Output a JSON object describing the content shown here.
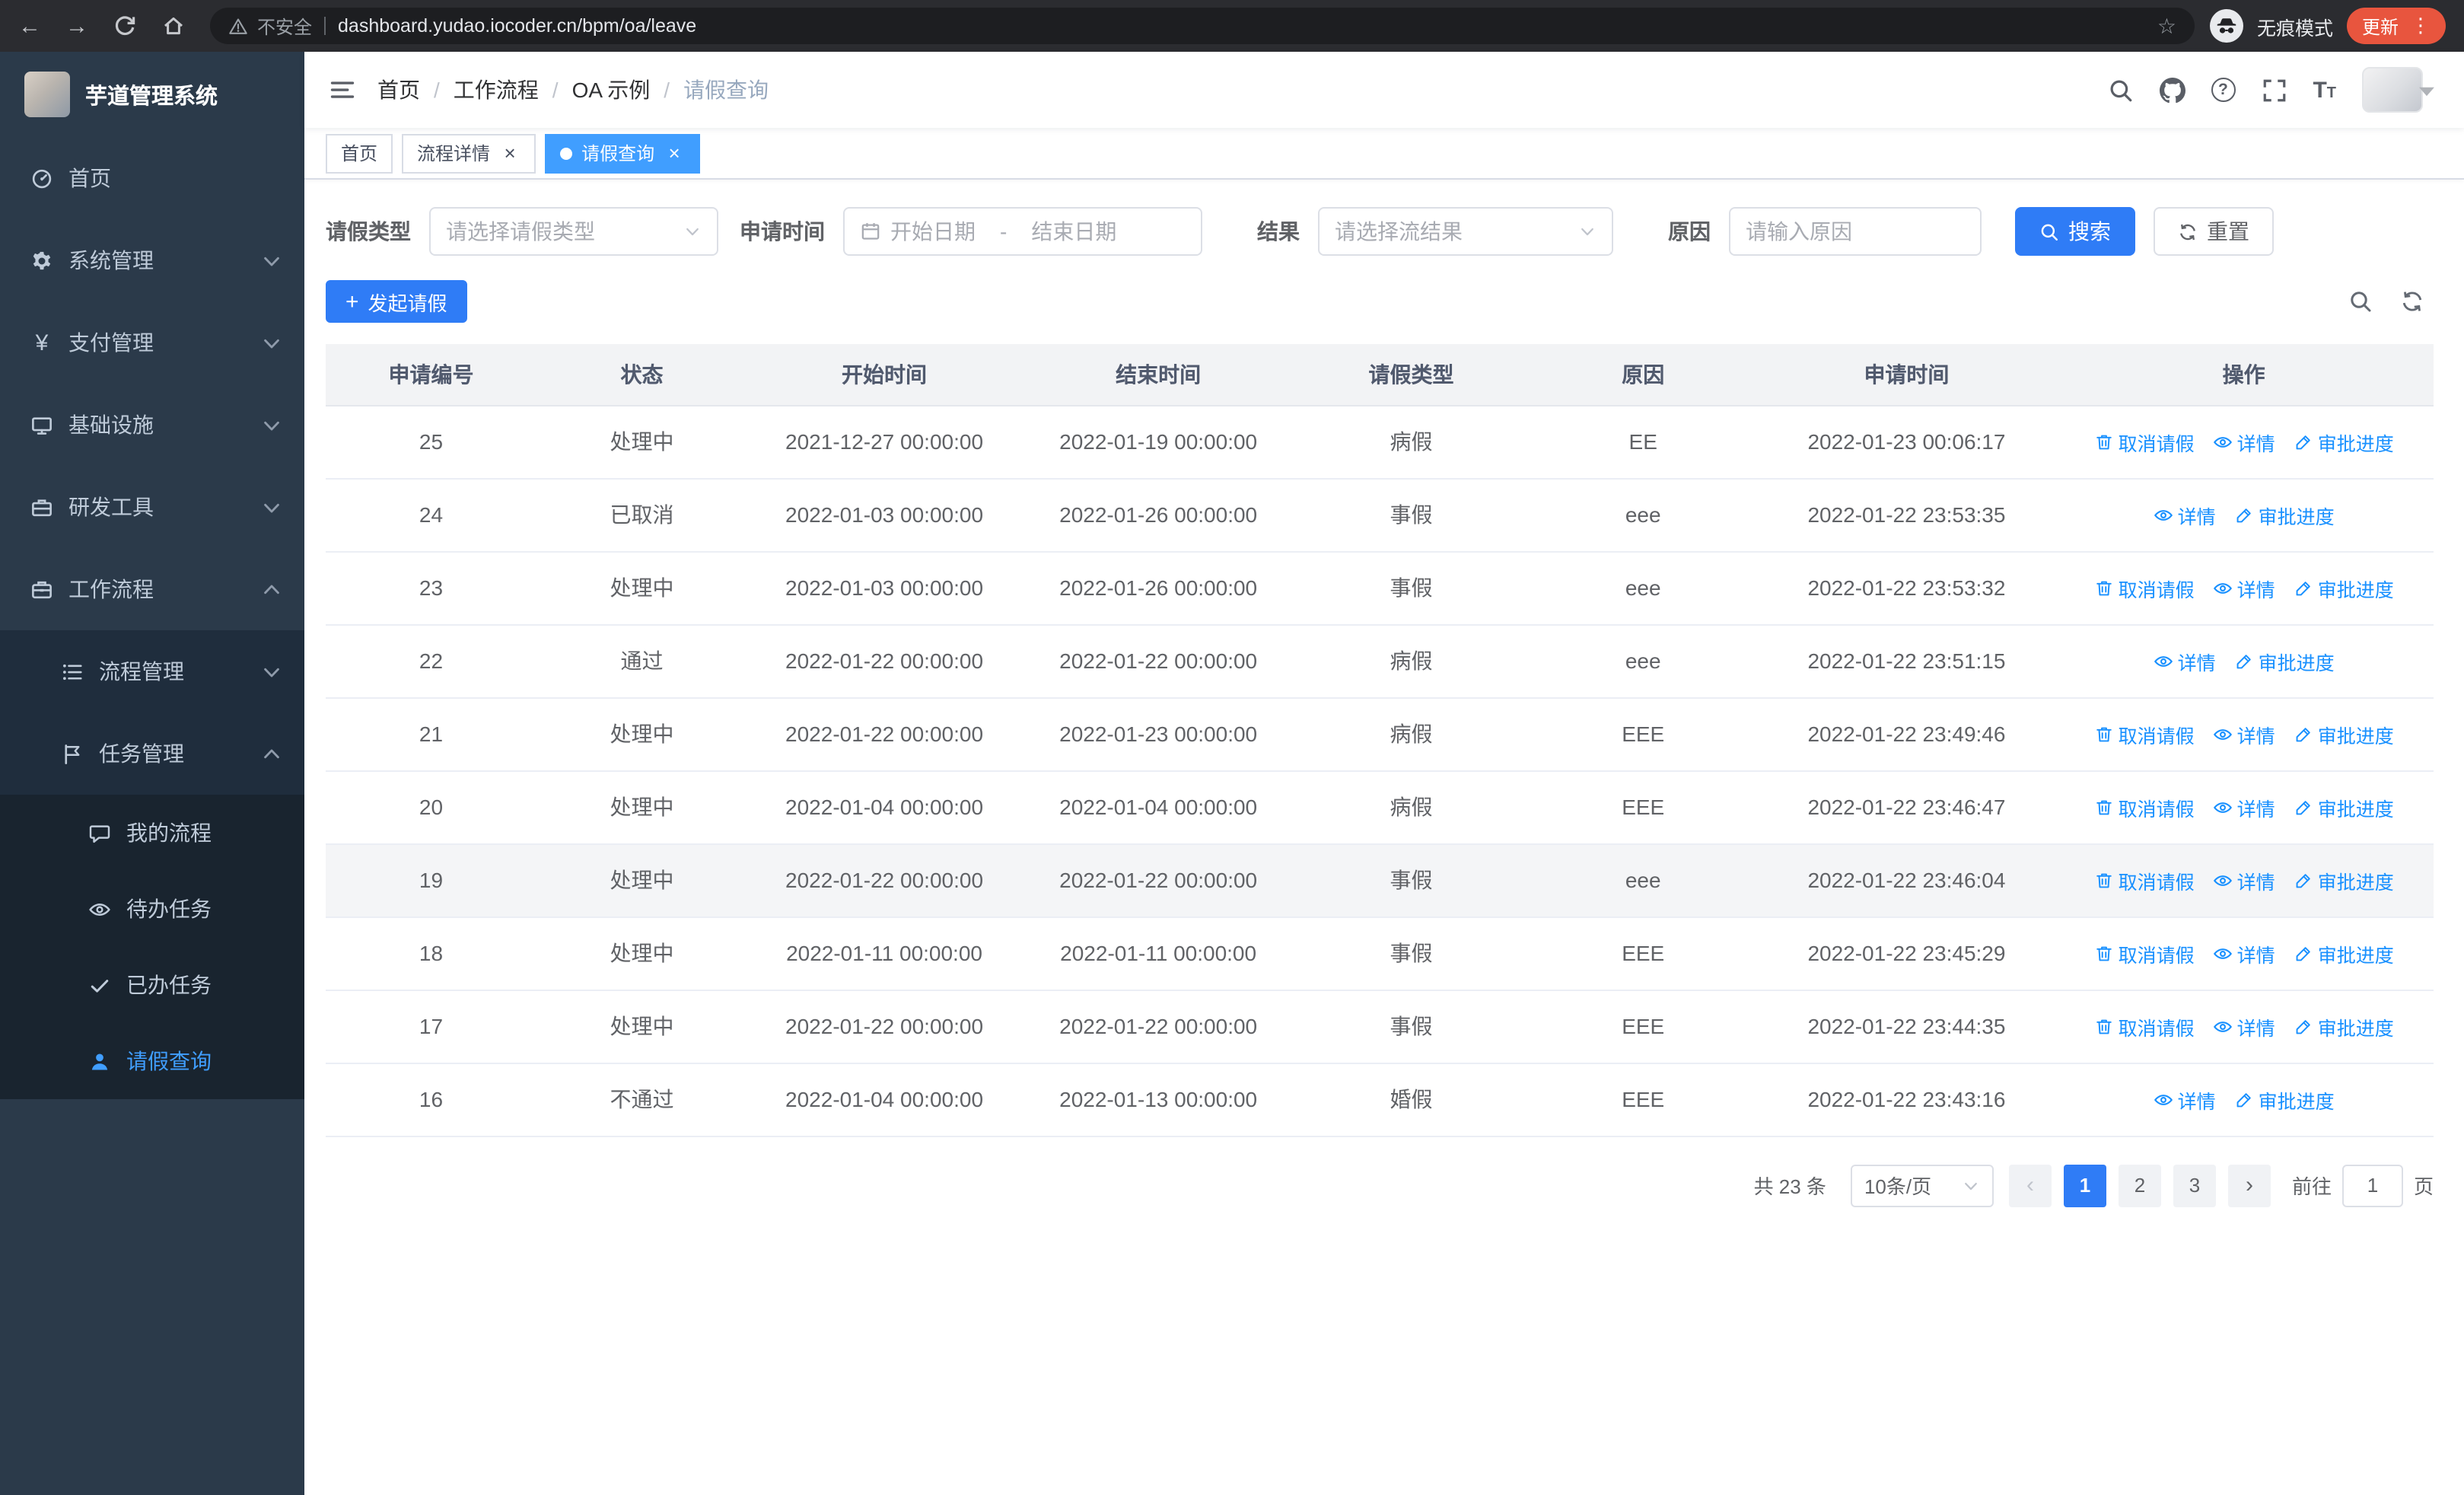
{
  "colors": {
    "primary_button": "#2f7cf6",
    "link": "#1890ff",
    "tab_active": "#409eff",
    "sidebar_bg": "#2b3a4a",
    "submenu_bg": "#1f2d3d",
    "submenu_deep_bg": "#19242f",
    "sidebar_text": "#bfcbd9",
    "update_pill": "#e8553e"
  },
  "browser": {
    "security_label": "不安全",
    "url": "dashboard.yudao.iocoder.cn/bpm/oa/leave",
    "incognito_label": "无痕模式",
    "update_label": "更新"
  },
  "sidebar": {
    "logo_title": "芋道管理系统",
    "items": [
      {
        "id": "home",
        "label": "首页",
        "icon": "dashboard-icon",
        "level": 1
      },
      {
        "id": "system",
        "label": "系统管理",
        "icon": "gear-icon",
        "level": 1,
        "chevron": "down"
      },
      {
        "id": "payment",
        "label": "支付管理",
        "icon": "yen-icon",
        "level": 1,
        "chevron": "down"
      },
      {
        "id": "infrastructure",
        "label": "基础设施",
        "icon": "infrastructure-icon",
        "level": 1,
        "chevron": "down"
      },
      {
        "id": "devtools",
        "label": "研发工具",
        "icon": "devtools-icon",
        "level": 1,
        "chevron": "down"
      },
      {
        "id": "workflow",
        "label": "工作流程",
        "icon": "workflow-icon",
        "level": 1,
        "chevron": "up"
      },
      {
        "id": "process-mgmt",
        "label": "流程管理",
        "icon": "process-list-icon",
        "level": 2,
        "chevron": "down"
      },
      {
        "id": "task-mgmt",
        "label": "任务管理",
        "icon": "task-icon",
        "level": 2,
        "chevron": "up"
      },
      {
        "id": "my-process",
        "label": "我的流程",
        "icon": "chat-icon",
        "level": 3
      },
      {
        "id": "todo-tasks",
        "label": "待办任务",
        "icon": "eye-icon",
        "level": 3
      },
      {
        "id": "done-tasks",
        "label": "已办任务",
        "icon": "check-icon",
        "level": 3
      },
      {
        "id": "leave-query",
        "label": "请假查询",
        "icon": "user-icon",
        "level": 3,
        "active": true
      }
    ]
  },
  "header": {
    "breadcrumb": [
      "首页",
      "工作流程",
      "OA 示例",
      "请假查询"
    ]
  },
  "tabs": [
    {
      "label": "首页",
      "closable": false,
      "active": false
    },
    {
      "label": "流程详情",
      "closable": true,
      "active": false
    },
    {
      "label": "请假查询",
      "closable": true,
      "active": true
    }
  ],
  "filters": {
    "leave_type_label": "请假类型",
    "leave_type_placeholder": "请选择请假类型",
    "apply_time_label": "申请时间",
    "start_placeholder": "开始日期",
    "range_separator": "-",
    "end_placeholder": "结束日期",
    "result_label": "结果",
    "result_placeholder": "请选择流结果",
    "reason_label": "原因",
    "reason_placeholder": "请输入原因",
    "search_label": "搜索",
    "reset_label": "重置"
  },
  "toolbar": {
    "create_label": "发起请假"
  },
  "table": {
    "headers": [
      "申请编号",
      "状态",
      "开始时间",
      "结束时间",
      "请假类型",
      "原因",
      "申请时间",
      "操作"
    ],
    "op_labels": {
      "cancel": "取消请假",
      "detail": "详情",
      "progress": "审批进度"
    },
    "rows": [
      {
        "id": "25",
        "status": "处理中",
        "start": "2021-12-27 00:00:00",
        "end": "2022-01-19 00:00:00",
        "type": "病假",
        "reason": "EE",
        "applied": "2022-01-23 00:06:17",
        "ops": [
          "cancel",
          "detail",
          "progress"
        ]
      },
      {
        "id": "24",
        "status": "已取消",
        "start": "2022-01-03 00:00:00",
        "end": "2022-01-26 00:00:00",
        "type": "事假",
        "reason": "eee",
        "applied": "2022-01-22 23:53:35",
        "ops": [
          "detail",
          "progress"
        ]
      },
      {
        "id": "23",
        "status": "处理中",
        "start": "2022-01-03 00:00:00",
        "end": "2022-01-26 00:00:00",
        "type": "事假",
        "reason": "eee",
        "applied": "2022-01-22 23:53:32",
        "ops": [
          "cancel",
          "detail",
          "progress"
        ]
      },
      {
        "id": "22",
        "status": "通过",
        "start": "2022-01-22 00:00:00",
        "end": "2022-01-22 00:00:00",
        "type": "病假",
        "reason": "eee",
        "applied": "2022-01-22 23:51:15",
        "ops": [
          "detail",
          "progress"
        ]
      },
      {
        "id": "21",
        "status": "处理中",
        "start": "2022-01-22 00:00:00",
        "end": "2022-01-23 00:00:00",
        "type": "病假",
        "reason": "EEE",
        "applied": "2022-01-22 23:49:46",
        "ops": [
          "cancel",
          "detail",
          "progress"
        ]
      },
      {
        "id": "20",
        "status": "处理中",
        "start": "2022-01-04 00:00:00",
        "end": "2022-01-04 00:00:00",
        "type": "病假",
        "reason": "EEE",
        "applied": "2022-01-22 23:46:47",
        "ops": [
          "cancel",
          "detail",
          "progress"
        ]
      },
      {
        "id": "19",
        "status": "处理中",
        "start": "2022-01-22 00:00:00",
        "end": "2022-01-22 00:00:00",
        "type": "事假",
        "reason": "eee",
        "applied": "2022-01-22 23:46:04",
        "ops": [
          "cancel",
          "detail",
          "progress"
        ],
        "hover": true
      },
      {
        "id": "18",
        "status": "处理中",
        "start": "2022-01-11 00:00:00",
        "end": "2022-01-11 00:00:00",
        "type": "事假",
        "reason": "EEE",
        "applied": "2022-01-22 23:45:29",
        "ops": [
          "cancel",
          "detail",
          "progress"
        ]
      },
      {
        "id": "17",
        "status": "处理中",
        "start": "2022-01-22 00:00:00",
        "end": "2022-01-22 00:00:00",
        "type": "事假",
        "reason": "EEE",
        "applied": "2022-01-22 23:44:35",
        "ops": [
          "cancel",
          "detail",
          "progress"
        ]
      },
      {
        "id": "16",
        "status": "不通过",
        "start": "2022-01-04 00:00:00",
        "end": "2022-01-13 00:00:00",
        "type": "婚假",
        "reason": "EEE",
        "applied": "2022-01-22 23:43:16",
        "ops": [
          "detail",
          "progress"
        ]
      }
    ]
  },
  "pagination": {
    "total_label": "共 23 条",
    "page_size_label": "10条/页",
    "pages": [
      "1",
      "2",
      "3"
    ],
    "active_page": "1",
    "goto_label": "前往",
    "goto_value": "1",
    "page_unit_label": "页"
  }
}
